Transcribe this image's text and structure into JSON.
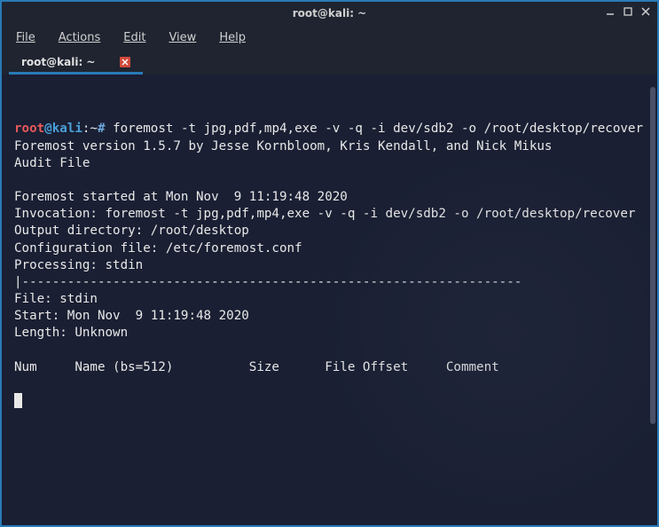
{
  "window": {
    "title": "root@kali: ~"
  },
  "menubar": {
    "file": "File",
    "actions": "Actions",
    "edit": "Edit",
    "view": "View",
    "help": "Help"
  },
  "tab": {
    "label": "root@kali: ~"
  },
  "terminal": {
    "prompt": {
      "user": "root",
      "at": "@",
      "host": "kali",
      "path": ":~",
      "hash": "#"
    },
    "command": " foremost -t jpg,pdf,mp4,exe -v -q -i dev/sdb2 -o /root/desktop/recover",
    "output_lines": [
      "Foremost version 1.5.7 by Jesse Kornbloom, Kris Kendall, and Nick Mikus",
      "Audit File",
      "",
      "Foremost started at Mon Nov  9 11:19:48 2020",
      "Invocation: foremost -t jpg,pdf,mp4,exe -v -q -i dev/sdb2 -o /root/desktop/recover",
      "Output directory: /root/desktop",
      "Configuration file: /etc/foremost.conf",
      "Processing: stdin",
      "|------------------------------------------------------------------",
      "File: stdin",
      "Start: Mon Nov  9 11:19:48 2020",
      "Length: Unknown",
      "",
      "Num     Name (bs=512)          Size      File Offset     Comment",
      ""
    ]
  }
}
